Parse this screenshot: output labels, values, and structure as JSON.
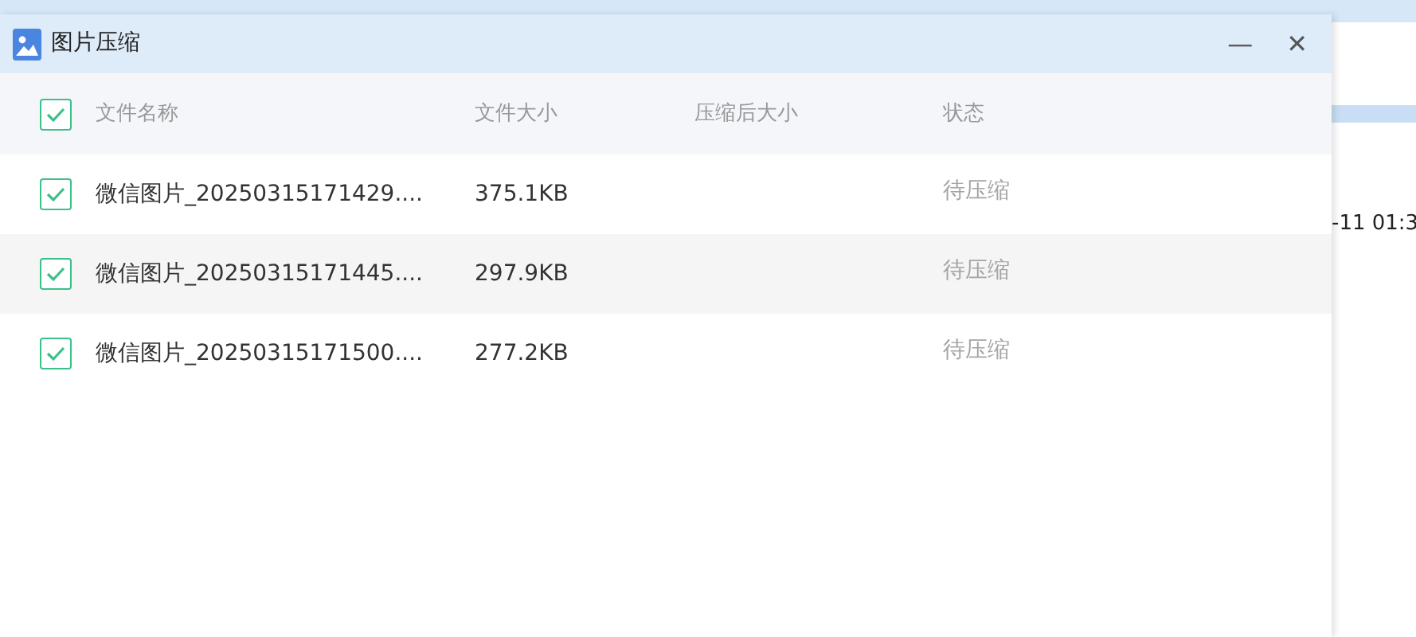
{
  "background_row": {
    "time": "-11 01:3"
  },
  "window": {
    "title": "图片压缩",
    "minimize": "—",
    "close": "✕"
  },
  "table": {
    "select_all_checked": true,
    "columns": [
      "文件名称",
      "文件大小",
      "压缩后大小",
      "状态"
    ],
    "rows": [
      {
        "checked": true,
        "name": "微信图片_20250315171429....",
        "size": "375.1KB",
        "status": "待压缩"
      },
      {
        "checked": true,
        "name": "微信图片_20250315171445....",
        "size": "297.9KB",
        "status": "待压缩"
      },
      {
        "checked": true,
        "name": "微信图片_20250315171500....",
        "size": "277.2KB",
        "status": "待压缩"
      }
    ]
  }
}
